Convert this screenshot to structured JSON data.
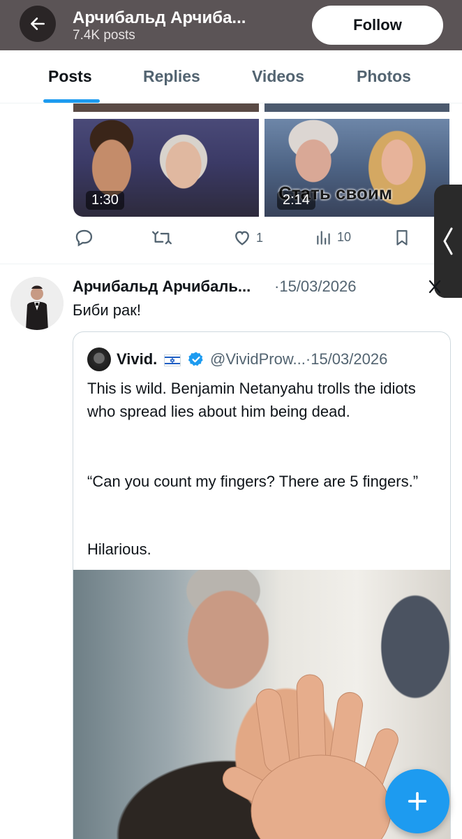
{
  "header": {
    "title": "Арчибальд Арчиба...",
    "posts_count": "7.4K posts",
    "follow_label": "Follow"
  },
  "tabs": [
    {
      "label": "Posts",
      "active": true
    },
    {
      "label": "Replies",
      "active": false
    },
    {
      "label": "Videos",
      "active": false
    },
    {
      "label": "Photos",
      "active": false
    }
  ],
  "previous_post": {
    "media": [
      {
        "duration": "1:30",
        "caption": ""
      },
      {
        "duration": "2:14",
        "caption": "Стать своим"
      }
    ],
    "actions": {
      "reply_count": "",
      "repost_count": "",
      "like_count": "1",
      "views_count": "10"
    }
  },
  "post": {
    "author_name": "Арчибальд Арчибаль...",
    "date": "15/03/2026",
    "text": "Биби рак!",
    "quote": {
      "author_name": "Vivid.",
      "handle": "@VividProw...",
      "date": "15/03/2026",
      "paragraphs": [
        "This is wild. Benjamin Netanyahu trolls the idiots who spread lies about him being dead.",
        "“Can you count my fingers? There are 5 fingers.”",
        "Hilarious."
      ]
    }
  },
  "colors": {
    "header_bg": "#5b5456",
    "accent": "#1d9bf0",
    "text": "#0f1419",
    "secondary_text": "#536471"
  }
}
